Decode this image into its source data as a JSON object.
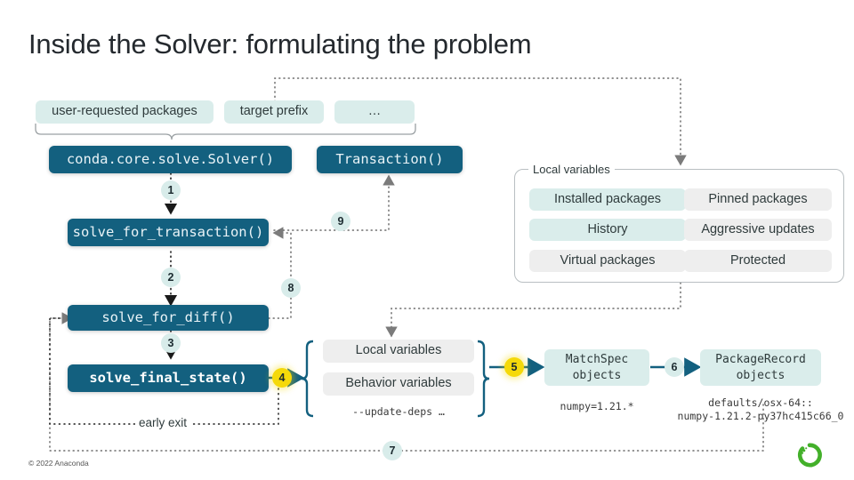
{
  "slide": {
    "title": "Inside the Solver: formulating the problem",
    "footer": "© 2022 Anaconda",
    "logo_name": "anaconda-logo",
    "logo_color": "#43b02a"
  },
  "colors": {
    "dark_teal": "#13607f",
    "light_teal": "#daedeb",
    "light_gray": "#eeeeee",
    "step_teal": "#d8ecea",
    "step_yellow": "#f5d90a",
    "arrow_gray": "#7b7b7b",
    "arrow_teal": "#13607f",
    "dotted_gray": "#6b6b6b",
    "frame_gray": "#b9bfc2"
  },
  "inputs": {
    "items": [
      {
        "label": "user-requested packages"
      },
      {
        "label": "target prefix"
      },
      {
        "label": "…"
      }
    ]
  },
  "entrypoints": {
    "solver": "conda.core.solve.Solver()",
    "transaction": "Transaction()"
  },
  "call_stack": {
    "items": [
      {
        "label": "solve_for_transaction()",
        "bold": false
      },
      {
        "label": "solve_for_diff()",
        "bold": false
      },
      {
        "label": "solve_final_state()",
        "bold": true
      }
    ]
  },
  "local_variables_group": {
    "legend": "Local variables",
    "items": [
      {
        "label": "Installed packages",
        "highlight": true
      },
      {
        "label": "Pinned packages",
        "highlight": false
      },
      {
        "label": "History",
        "highlight": true
      },
      {
        "label": "Aggressive updates",
        "highlight": false
      },
      {
        "label": "Virtual packages",
        "highlight": false
      },
      {
        "label": "Protected",
        "highlight": false
      }
    ]
  },
  "variables_group": {
    "items": [
      {
        "label": "Local variables"
      },
      {
        "label": "Behavior variables"
      }
    ],
    "caption": "--update-deps …"
  },
  "objects": {
    "matchspec": {
      "line1": "MatchSpec",
      "line2": "objects",
      "caption": "numpy=1.21.*"
    },
    "packagerecord": {
      "line1": "PackageRecord",
      "line2": "objects",
      "caption_line1": "defaults/osx-64::",
      "caption_line2": "numpy-1.21.2-py37hc415c66_0"
    }
  },
  "steps": [
    {
      "n": "1",
      "kind": "teal"
    },
    {
      "n": "2",
      "kind": "teal"
    },
    {
      "n": "3",
      "kind": "teal"
    },
    {
      "n": "4",
      "kind": "yellow"
    },
    {
      "n": "5",
      "kind": "yellow"
    },
    {
      "n": "6",
      "kind": "teal"
    },
    {
      "n": "7",
      "kind": "teal"
    },
    {
      "n": "8",
      "kind": "teal"
    },
    {
      "n": "9",
      "kind": "teal"
    }
  ],
  "annotations": {
    "early_exit": "early exit"
  }
}
